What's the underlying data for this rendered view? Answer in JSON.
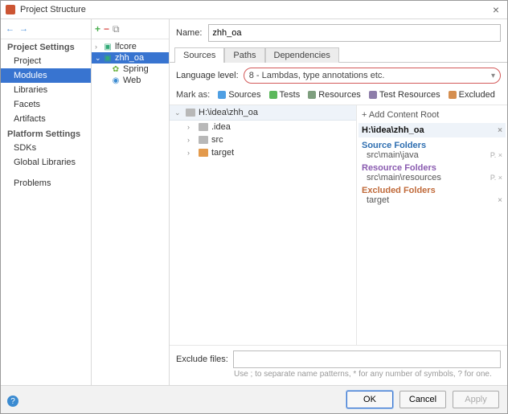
{
  "window": {
    "title": "Project Structure",
    "close": "×"
  },
  "sidebar": {
    "nav_back": "←",
    "nav_fwd": "→",
    "section1": "Project Settings",
    "items1": [
      "Project",
      "Modules",
      "Libraries",
      "Facets",
      "Artifacts"
    ],
    "selected1": 1,
    "section2": "Platform Settings",
    "items2": [
      "SDKs",
      "Global Libraries"
    ],
    "section3": "",
    "items3": [
      "Problems"
    ]
  },
  "midtree": {
    "toolbar": {
      "plus": "+",
      "minus": "−",
      "copy": "⧉"
    },
    "nodes": [
      {
        "depth": 1,
        "expander": "›",
        "icon": "module-icon",
        "label": "lfcore"
      },
      {
        "depth": 1,
        "expander": "⌄",
        "icon": "module-icon",
        "label": "zhh_oa",
        "selected": true
      },
      {
        "depth": 2,
        "expander": "",
        "icon": "spring-icon",
        "label": "Spring"
      },
      {
        "depth": 2,
        "expander": "",
        "icon": "web-icon",
        "label": "Web"
      }
    ]
  },
  "main": {
    "name_label": "Name:",
    "name_value": "zhh_oa",
    "tabs": [
      "Sources",
      "Paths",
      "Dependencies"
    ],
    "active_tab": 0,
    "lang_label": "Language level:",
    "lang_value": "8 - Lambdas, type annotations etc.",
    "mark_label": "Mark as:",
    "marks": [
      {
        "key": "sources",
        "label": "Sources",
        "cls": "mk-src"
      },
      {
        "key": "tests",
        "label": "Tests",
        "cls": "mk-test"
      },
      {
        "key": "resources",
        "label": "Resources",
        "cls": "mk-res"
      },
      {
        "key": "test-resources",
        "label": "Test Resources",
        "cls": "mk-tres"
      },
      {
        "key": "excluded",
        "label": "Excluded",
        "cls": "mk-excl"
      }
    ],
    "folder_head": "H:\\idea\\zhh_oa",
    "folders": [
      {
        "expander": "›",
        "cls": "",
        "label": ".idea"
      },
      {
        "expander": "›",
        "cls": "",
        "label": "src"
      },
      {
        "expander": "›",
        "cls": "orange",
        "label": "target"
      }
    ],
    "roots": {
      "add_label": "+ Add Content Root",
      "root_path": "H:\\idea\\zhh_oa",
      "groups": [
        {
          "title": "Source Folders",
          "cls": "grp-src",
          "entries": [
            {
              "path": "src\\main\\java",
              "icons": true
            }
          ]
        },
        {
          "title": "Resource Folders",
          "cls": "grp-res",
          "entries": [
            {
              "path": "src\\main\\resources",
              "icons": true
            }
          ]
        },
        {
          "title": "Excluded Folders",
          "cls": "grp-excl",
          "entries": [
            {
              "path": "target",
              "icons": false
            }
          ]
        }
      ]
    },
    "exclude_label": "Exclude files:",
    "exclude_value": "",
    "exclude_hint": "Use ; to separate name patterns, * for any number of symbols, ? for one."
  },
  "buttons": {
    "ok": "OK",
    "cancel": "Cancel",
    "apply": "Apply"
  },
  "help": "?"
}
